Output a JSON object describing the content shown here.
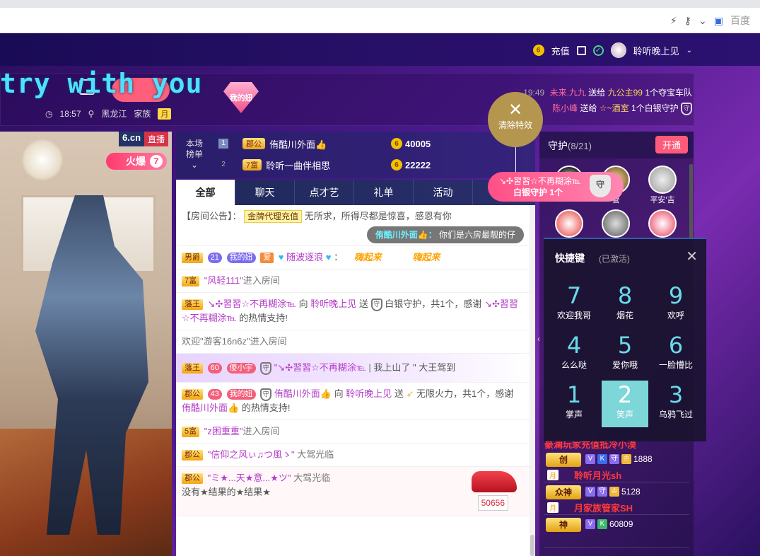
{
  "browser": {
    "search_engine": "百度"
  },
  "topnav": {
    "recharge_label": "充值",
    "username": "聆听晚上见"
  },
  "header": {
    "room_title": "try with you",
    "follow_label": "关注",
    "time": "18:57",
    "location": "黑龙江",
    "family_label": "家族",
    "family_tag": "月",
    "my_girl_label": "我的妞"
  },
  "gift_ticker": [
    {
      "time": "19:49",
      "sender": "未来.九九",
      "verb": "送给",
      "receiver": "九公主99",
      "text": "1个夺宝车队"
    },
    {
      "time": "",
      "sender": "陈小峰",
      "verb": "送给",
      "receiver": "☆~酒室",
      "text": "1个白银守护"
    }
  ],
  "video": {
    "site_badge": "6.cn",
    "live_badge": "直播",
    "hot_label": "火爆",
    "hot_level": "7"
  },
  "rank": {
    "label_line1": "本场",
    "label_line2": "榜单",
    "rows": [
      {
        "num": "1",
        "chip": "郡公",
        "name": "侑酷川外面👍",
        "value": "40005"
      },
      {
        "num": "2",
        "chip": "7富",
        "name": "聆听一曲伴相思",
        "value": "22222"
      }
    ]
  },
  "clear_effects": {
    "label": "清除特效"
  },
  "guard_popup": {
    "line1": "↘✣習習☆不再糊涂℡",
    "line2": "白银守护 1个",
    "shield": "守"
  },
  "chat": {
    "tabs": [
      "全部",
      "聊天",
      "点才艺",
      "礼单",
      "活动"
    ],
    "notice_prefix": "【房间公告】：",
    "notice_chip": "金牌代理充值",
    "notice_text": "无所求，所得尽都是惊喜，感恩有你",
    "pill_name": "侑酷川外面👍：",
    "pill_text": "你们是六房最靓的仔",
    "msg1_badge": "男爵",
    "msg1_lv": "21",
    "msg1_tag": "我的妞",
    "msg1_tag2": "爱",
    "msg1_name": "随波逐浪",
    "msg1_sticker1": "嗨起来",
    "msg1_sticker2": "嗨起来",
    "msg2_badge": "7富",
    "msg2_name": "\"风轻111\"",
    "msg2_text": "进入房间",
    "msg3_badge": "藩王",
    "msg3_name": "↘✣習習☆不再糊涂℡",
    "msg3_mid": "向",
    "msg3_to": "聆听晚上见",
    "msg3_send": "送",
    "msg3_gift": "白银守护，共1个，感谢",
    "msg3_name2": "↘✣習習☆不再糊涂℡",
    "msg3_end": "的热情支持!",
    "msg4_text": "欢迎\"游客16n6z\"进入房间",
    "msg5_badge": "藩王",
    "msg5_lv": "60",
    "msg5_tag": "傻小宇",
    "msg5_name": "\"↘✣習習☆不再糊涂℡",
    "msg5_sep": "|",
    "msg5_text": "我上山了 \"",
    "msg5_end": "大王驾到",
    "msg6_badge": "郡公",
    "msg6_lv": "43",
    "msg6_tag": "我的妞",
    "msg6_name": "侑酷川外面👍",
    "msg6_mid": "向",
    "msg6_to": "聆听晚上见",
    "msg6_send": "送",
    "msg6_gift": "无限火力，共1个，感谢",
    "msg6_name2": "侑酷川外面👍",
    "msg6_end": "的热情支持!",
    "msg7_badge": "5富",
    "msg7_name": "\"z困重重\"",
    "msg7_text": "进入房间",
    "msg8_badge": "郡公",
    "msg8_name": "\"信仰之风ぃ♫つ風ゝ\"",
    "msg8_text": "大驾光临",
    "msg9_badge": "郡公",
    "msg9_name": "\"ミ★...天★意...★ツ\"",
    "msg9_text": "大驾光临",
    "msg9_line2": "没有★结果的★结果★",
    "msg9_car_count": "50656"
  },
  "guards": {
    "title": "守护",
    "count": "(8/21)",
    "open_label": "开通",
    "names": [
      "",
      "管",
      "平安'吉",
      "",
      "",
      ""
    ],
    "shield": "守"
  },
  "shortcut": {
    "title": "快捷键",
    "status": "(已激活)",
    "cells": [
      {
        "num": "7",
        "label": "欢迎我哥"
      },
      {
        "num": "8",
        "label": "烟花"
      },
      {
        "num": "9",
        "label": "欢呼"
      },
      {
        "num": "4",
        "label": "么么哒"
      },
      {
        "num": "5",
        "label": "爱你哦"
      },
      {
        "num": "6",
        "label": "一脸懵比"
      },
      {
        "num": "1",
        "label": "掌声"
      },
      {
        "num": "2",
        "label": "笑声"
      },
      {
        "num": "3",
        "label": "乌鸦飞过"
      }
    ]
  },
  "fans": {
    "banner": "豪澜玩家充值抵冷小漠",
    "rows": [
      {
        "icon": "创",
        "tags": [
          "V",
          "K",
          "守"
        ],
        "points": "1888",
        "name": "聆听月光sh",
        "month": "月"
      },
      {
        "icon": "众神",
        "tags": [
          "V",
          "守"
        ],
        "points": "5128",
        "name": "月家族管家SH",
        "month": "月"
      },
      {
        "icon": "神",
        "tags": [
          "V",
          "K"
        ],
        "points": "60809",
        "name": "",
        "month": ""
      }
    ]
  },
  "colors": {
    "accent_pink": "#ff5f7a",
    "chat_purple": "#b33cc7",
    "shortcut_cyan": "#7dd6d8"
  }
}
